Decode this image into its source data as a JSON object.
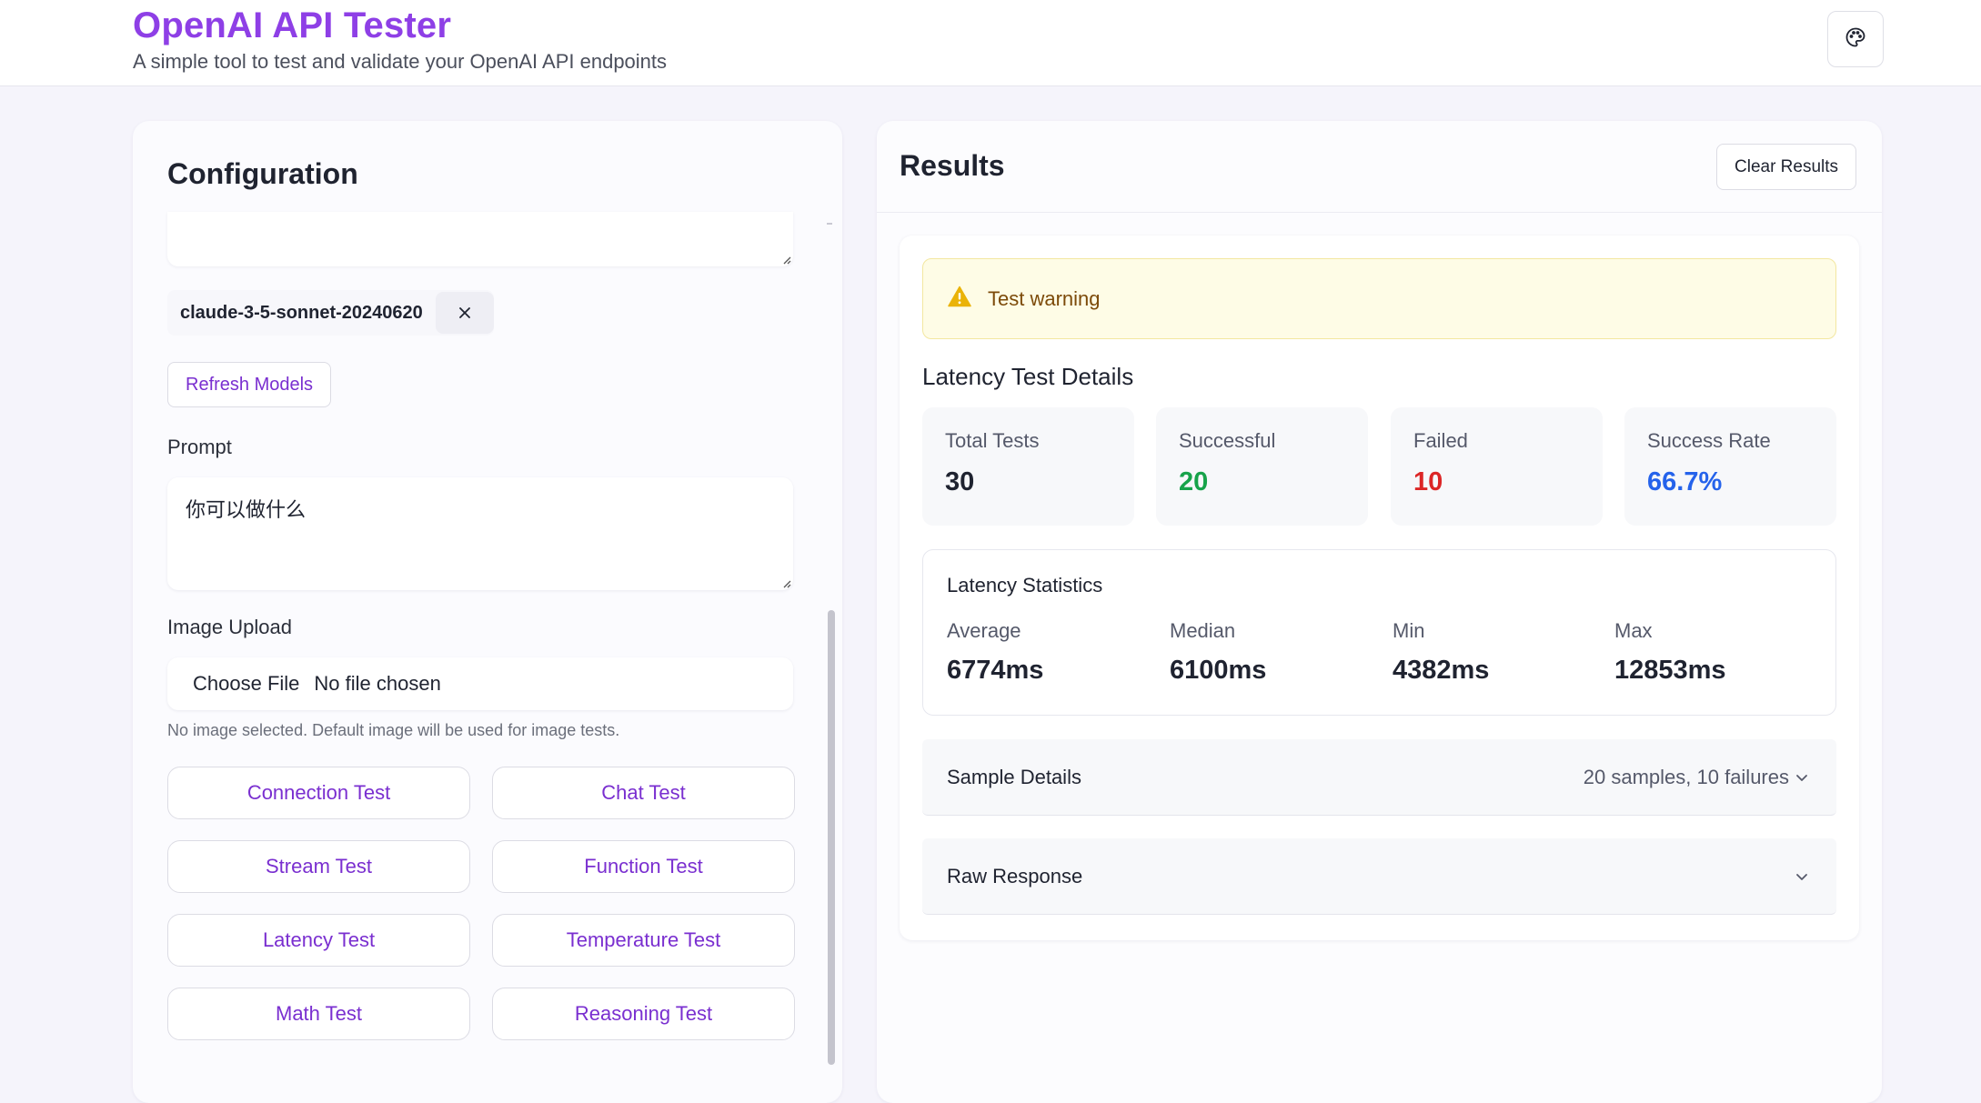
{
  "header": {
    "title": "OpenAI API Tester",
    "subtitle": "A simple tool to test and validate your OpenAI API endpoints",
    "theme_icon": "palette-icon"
  },
  "config": {
    "title": "Configuration",
    "selected_model": "claude-3-5-sonnet-20240620",
    "refresh_models_label": "Refresh Models",
    "prompt_label": "Prompt",
    "prompt_value": "你可以做什么",
    "image_upload_label": "Image Upload",
    "file_button_label": "Choose File",
    "file_status": "No file chosen",
    "image_hint": "No image selected. Default image will be used for image tests.",
    "tests": [
      "Connection Test",
      "Chat Test",
      "Stream Test",
      "Function Test",
      "Latency Test",
      "Temperature Test",
      "Math Test",
      "Reasoning Test"
    ]
  },
  "results": {
    "title": "Results",
    "clear_label": "Clear Results",
    "warning": "Test warning",
    "details_title": "Latency Test Details",
    "stats": [
      {
        "label": "Total Tests",
        "value": "30",
        "color": "#1f2330"
      },
      {
        "label": "Successful",
        "value": "20",
        "color": "#17a34a"
      },
      {
        "label": "Failed",
        "value": "10",
        "color": "#dc2626"
      },
      {
        "label": "Success Rate",
        "value": "66.7%",
        "color": "#2563eb"
      }
    ],
    "latency": {
      "title": "Latency Statistics",
      "items": [
        {
          "label": "Average",
          "value": "6774ms"
        },
        {
          "label": "Median",
          "value": "6100ms"
        },
        {
          "label": "Min",
          "value": "4382ms"
        },
        {
          "label": "Max",
          "value": "12853ms"
        }
      ]
    },
    "sample_details": {
      "title": "Sample Details",
      "meta": "20 samples, 10 failures"
    },
    "raw_response": {
      "title": "Raw Response"
    }
  },
  "colors": {
    "brand": "#8e3fe6",
    "accent_text": "#7a2fd0",
    "warning_bg": "#fefce6",
    "warning_icon": "#eab308"
  }
}
